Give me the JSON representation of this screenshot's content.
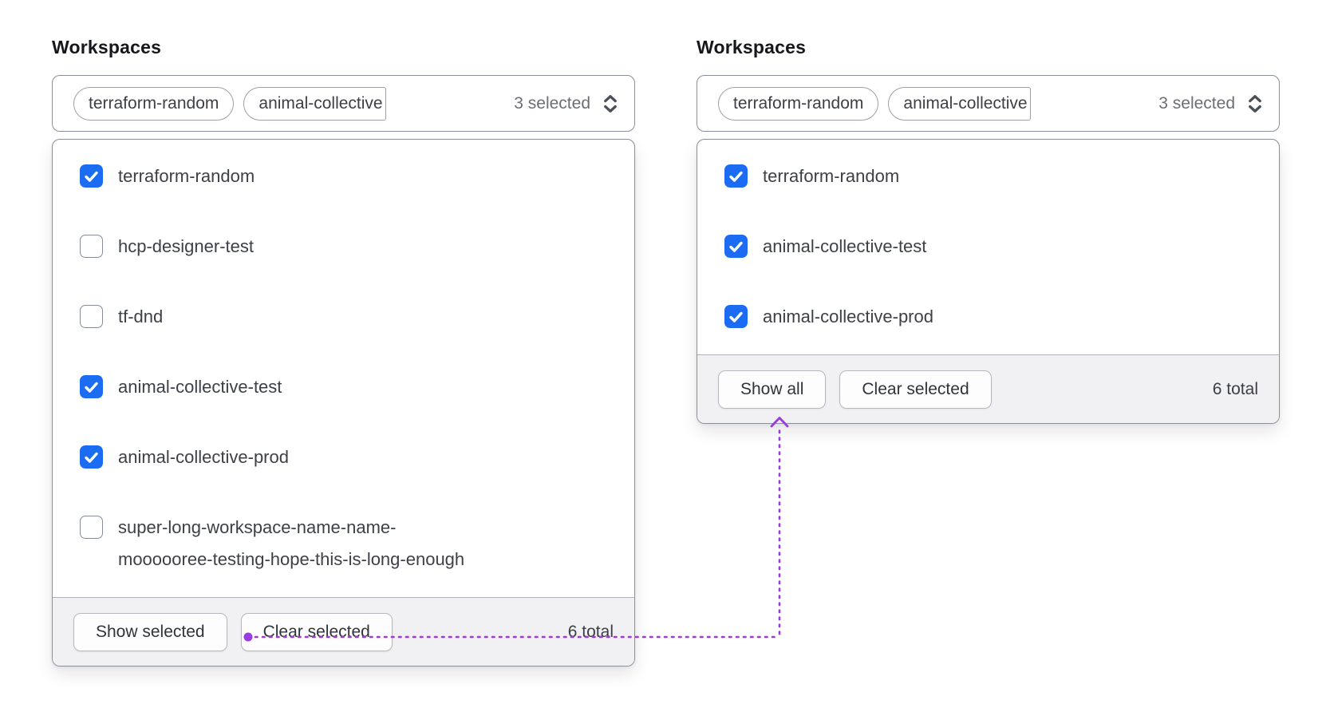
{
  "colors": {
    "checkbox_blue": "#1b6cf2",
    "annotation_purple": "#9a3be0"
  },
  "panels": [
    {
      "label": "Workspaces",
      "trigger": {
        "tags": [
          {
            "label": "terraform-random"
          },
          {
            "label": "animal-collective"
          }
        ],
        "count": "3 selected"
      },
      "options": [
        {
          "label": "terraform-random",
          "checked": true
        },
        {
          "label": "hcp-designer-test",
          "checked": false
        },
        {
          "label": "tf-dnd",
          "checked": false
        },
        {
          "label": "animal-collective-test",
          "checked": true
        },
        {
          "label": "animal-collective-prod",
          "checked": true
        },
        {
          "label": "super-long-workspace-name-name-moooooree-testing-hope-this-is-long-enough",
          "line1": "super-long-workspace-name-name-",
          "line2": "moooooree-testing-hope-this-is-long-enough",
          "checked": false
        }
      ],
      "footer": {
        "show_button": "Show selected",
        "clear_button": "Clear selected",
        "total": "6 total"
      }
    },
    {
      "label": "Workspaces",
      "trigger": {
        "tags": [
          {
            "label": "terraform-random"
          },
          {
            "label": "animal-collective"
          }
        ],
        "count": "3 selected"
      },
      "options": [
        {
          "label": "terraform-random",
          "checked": true
        },
        {
          "label": "animal-collective-test",
          "checked": true
        },
        {
          "label": "animal-collective-prod",
          "checked": true
        }
      ],
      "footer": {
        "show_button": "Show all",
        "clear_button": "Clear selected",
        "total": "6 total"
      }
    }
  ]
}
